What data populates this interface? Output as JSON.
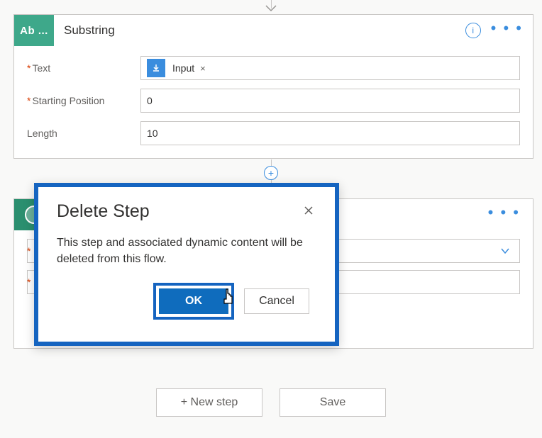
{
  "card1": {
    "badge": "Ab ...",
    "title": "Substring",
    "fields": {
      "text_label": "Text",
      "text_token": "Input",
      "text_token_remove": "×",
      "start_label": "Starting Position",
      "start_value": "0",
      "length_label": "Length",
      "length_value": "10"
    }
  },
  "dialog": {
    "title": "Delete Step",
    "body": "This step and associated dynamic content will be deleted from this flow.",
    "ok": "OK",
    "cancel": "Cancel"
  },
  "bottom": {
    "new_step": "+ New step",
    "save": "Save"
  },
  "icons": {
    "info": "i",
    "add": "+"
  }
}
